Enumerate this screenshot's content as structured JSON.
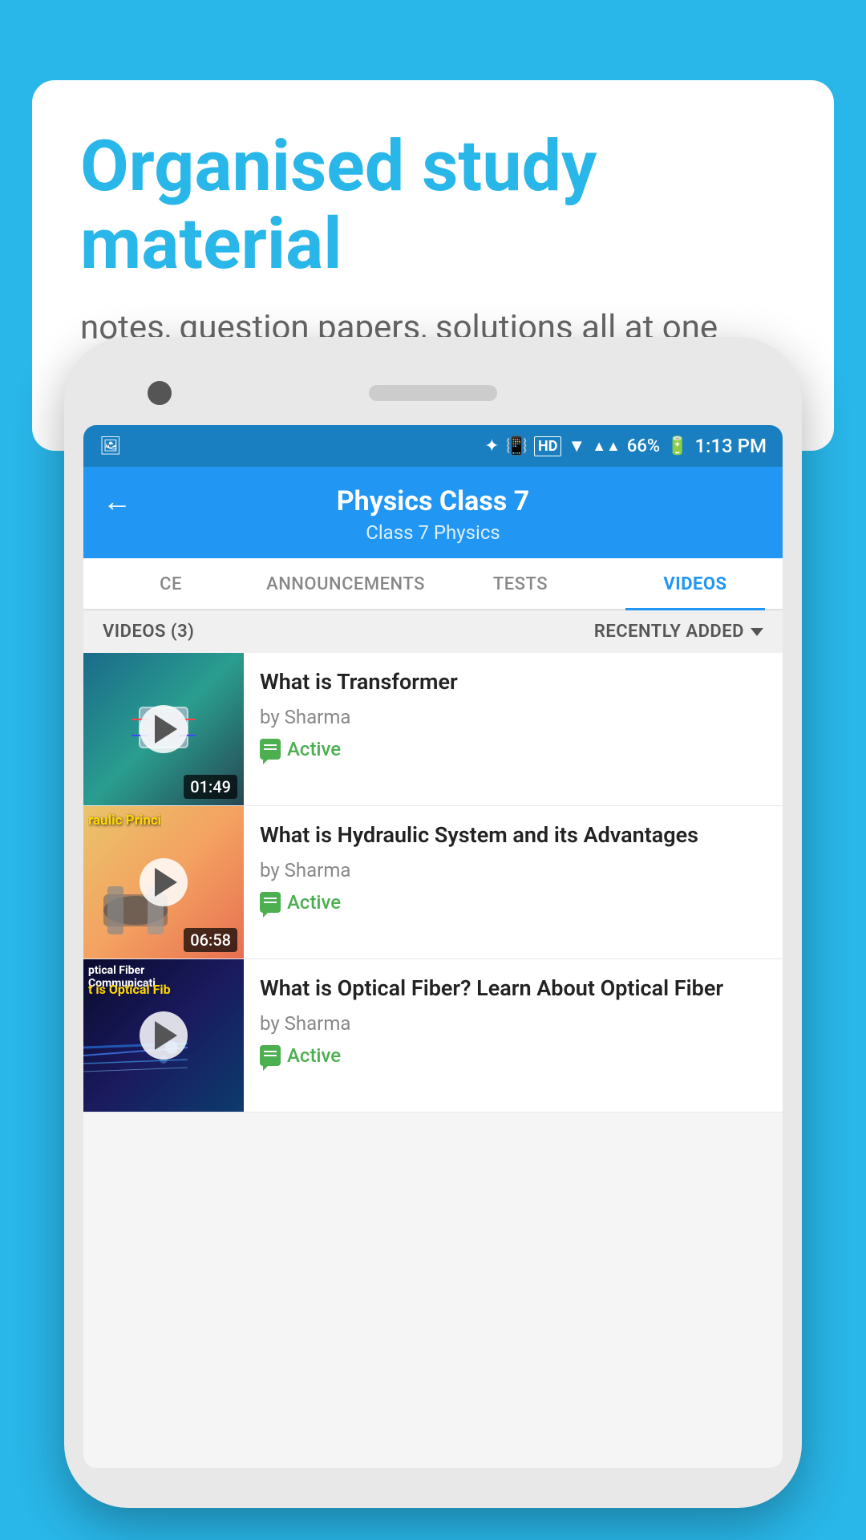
{
  "banner": {
    "title": "Organised study material",
    "subtitle": "notes, question papers, solutions all at one place"
  },
  "statusBar": {
    "time": "1:13 PM",
    "battery": "66%",
    "signal": "HD"
  },
  "header": {
    "title": "Physics Class 7",
    "breadcrumb": "Class 7    Physics",
    "backLabel": "←"
  },
  "tabs": [
    {
      "id": "ce",
      "label": "CE",
      "active": false
    },
    {
      "id": "announcements",
      "label": "ANNOUNCEMENTS",
      "active": false
    },
    {
      "id": "tests",
      "label": "TESTS",
      "active": false
    },
    {
      "id": "videos",
      "label": "VIDEOS",
      "active": true
    }
  ],
  "videosSection": {
    "countLabel": "VIDEOS (3)",
    "sortLabel": "RECENTLY ADDED"
  },
  "videos": [
    {
      "id": "v1",
      "title": "What is  Transformer",
      "author": "by Sharma",
      "status": "Active",
      "duration": "01:49",
      "thumbType": "transformer",
      "thumbLabel": ""
    },
    {
      "id": "v2",
      "title": "What is Hydraulic System and its Advantages",
      "author": "by Sharma",
      "status": "Active",
      "duration": "06:58",
      "thumbType": "hydraulic",
      "thumbLabel": "raulic Princi"
    },
    {
      "id": "v3",
      "title": "What is Optical Fiber? Learn About Optical Fiber",
      "author": "by Sharma",
      "status": "Active",
      "duration": "",
      "thumbType": "optical",
      "thumbLabel": "ptical Fiber Communicati"
    }
  ]
}
